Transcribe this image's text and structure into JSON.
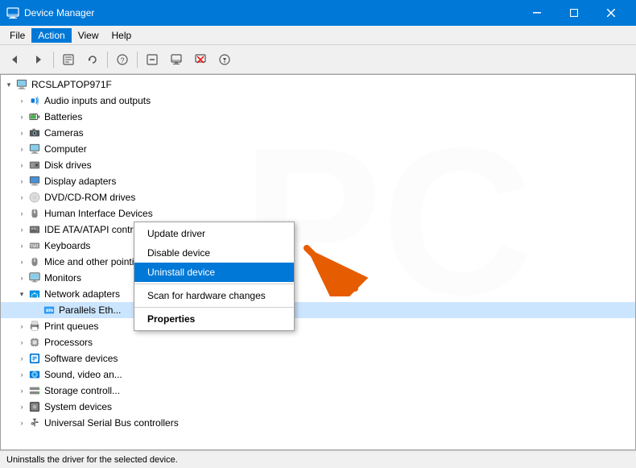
{
  "titleBar": {
    "title": "Device Manager",
    "icon": "device-manager"
  },
  "menuBar": {
    "items": [
      {
        "label": "File",
        "id": "file"
      },
      {
        "label": "Action",
        "id": "action",
        "active": true
      },
      {
        "label": "View",
        "id": "view"
      },
      {
        "label": "Help",
        "id": "help"
      }
    ]
  },
  "toolbar": {
    "buttons": [
      {
        "label": "◀",
        "name": "back-button"
      },
      {
        "label": "▶",
        "name": "forward-button"
      },
      {
        "label": "⊞",
        "name": "properties-button"
      },
      {
        "label": "↺",
        "name": "refresh-button"
      },
      {
        "label": "?",
        "name": "help-button"
      },
      {
        "label": "⊟",
        "name": "expand-button"
      },
      {
        "label": "🖥",
        "name": "computer-button"
      },
      {
        "label": "✕",
        "name": "remove-button"
      },
      {
        "label": "⬇",
        "name": "download-button"
      }
    ]
  },
  "treeView": {
    "rootNode": "RCSLAPTOP971F",
    "items": [
      {
        "id": "root",
        "label": "RCSLAPTOP971F",
        "indent": 0,
        "expanded": true,
        "icon": "💻"
      },
      {
        "id": "audio",
        "label": "Audio inputs and outputs",
        "indent": 1,
        "expanded": false,
        "icon": "🔊"
      },
      {
        "id": "batteries",
        "label": "Batteries",
        "indent": 1,
        "expanded": false,
        "icon": "🔋"
      },
      {
        "id": "cameras",
        "label": "Cameras",
        "indent": 1,
        "expanded": false,
        "icon": "📷"
      },
      {
        "id": "computer",
        "label": "Computer",
        "indent": 1,
        "expanded": false,
        "icon": "🖥"
      },
      {
        "id": "disk",
        "label": "Disk drives",
        "indent": 1,
        "expanded": false,
        "icon": "💾"
      },
      {
        "id": "display",
        "label": "Display adapters",
        "indent": 1,
        "expanded": false,
        "icon": "🖥"
      },
      {
        "id": "dvd",
        "label": "DVD/CD-ROM drives",
        "indent": 1,
        "expanded": false,
        "icon": "💿"
      },
      {
        "id": "hid",
        "label": "Human Interface Devices",
        "indent": 1,
        "expanded": false,
        "icon": "🎮"
      },
      {
        "id": "ide",
        "label": "IDE ATA/ATAPI controllers",
        "indent": 1,
        "expanded": false,
        "icon": "⚙"
      },
      {
        "id": "keyboards",
        "label": "Keyboards",
        "indent": 1,
        "expanded": false,
        "icon": "⌨"
      },
      {
        "id": "mice",
        "label": "Mice and other pointing devices",
        "indent": 1,
        "expanded": false,
        "icon": "🖱"
      },
      {
        "id": "monitors",
        "label": "Monitors",
        "indent": 1,
        "expanded": false,
        "icon": "🖥"
      },
      {
        "id": "network",
        "label": "Network adapters",
        "indent": 1,
        "expanded": true,
        "icon": "🌐"
      },
      {
        "id": "parallels",
        "label": "Parallels Eth...",
        "indent": 2,
        "expanded": false,
        "icon": "🌐",
        "selected": true
      },
      {
        "id": "print",
        "label": "Print queues",
        "indent": 1,
        "expanded": false,
        "icon": "🖨"
      },
      {
        "id": "processors",
        "label": "Processors",
        "indent": 1,
        "expanded": false,
        "icon": "⚙"
      },
      {
        "id": "software",
        "label": "Software devices",
        "indent": 1,
        "expanded": false,
        "icon": "📦"
      },
      {
        "id": "sound",
        "label": "Sound, video an...",
        "indent": 1,
        "expanded": false,
        "icon": "🔊"
      },
      {
        "id": "storage",
        "label": "Storage controll...",
        "indent": 1,
        "expanded": false,
        "icon": "💾"
      },
      {
        "id": "system",
        "label": "System devices",
        "indent": 1,
        "expanded": false,
        "icon": "⚙"
      },
      {
        "id": "usb",
        "label": "Universal Serial Bus controllers",
        "indent": 1,
        "expanded": false,
        "icon": "🔌"
      }
    ]
  },
  "contextMenu": {
    "items": [
      {
        "label": "Update driver",
        "id": "update-driver",
        "bold": false
      },
      {
        "label": "Disable device",
        "id": "disable-device",
        "bold": false
      },
      {
        "label": "Uninstall device",
        "id": "uninstall-device",
        "bold": false,
        "highlighted": true
      },
      {
        "separator": true
      },
      {
        "label": "Scan for hardware changes",
        "id": "scan-hardware",
        "bold": false
      },
      {
        "separator": true
      },
      {
        "label": "Properties",
        "id": "properties",
        "bold": true
      }
    ]
  },
  "statusBar": {
    "text": "Uninstalls the driver for the selected device."
  },
  "colors": {
    "titleBarBg": "#0078d7",
    "menuActiveBg": "#0078d7",
    "ctxHighlightBg": "#0078d7",
    "selectedItemBg": "#cce5ff"
  }
}
